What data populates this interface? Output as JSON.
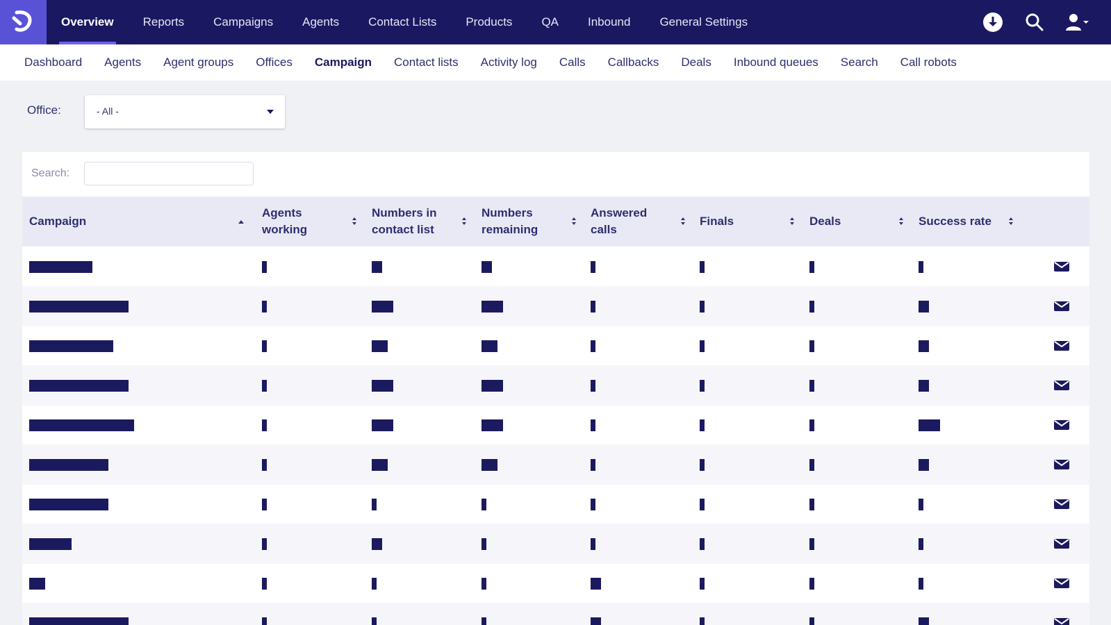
{
  "topnav": {
    "items": [
      "Overview",
      "Reports",
      "Campaigns",
      "Agents",
      "Contact Lists",
      "Products",
      "QA",
      "Inbound",
      "General Settings"
    ],
    "active_index": 0,
    "icons": [
      "download-icon",
      "search-icon",
      "user-menu-icon"
    ]
  },
  "subnav": {
    "items": [
      "Dashboard",
      "Agents",
      "Agent groups",
      "Offices",
      "Campaign",
      "Contact lists",
      "Activity log",
      "Calls",
      "Callbacks",
      "Deals",
      "Inbound queues",
      "Search",
      "Call robots"
    ],
    "active_index": 4
  },
  "filter": {
    "office_label": "Office:",
    "office_value": "- All -"
  },
  "table": {
    "search_label": "Search:",
    "search_value": "",
    "columns": [
      {
        "label": "Campaign",
        "sort": "asc"
      },
      {
        "label": "Agents working",
        "sort": "both"
      },
      {
        "label": "Numbers in contact list",
        "sort": "both"
      },
      {
        "label": "Numbers remaining",
        "sort": "both"
      },
      {
        "label": "Answered calls",
        "sort": "both"
      },
      {
        "label": "Finals",
        "sort": "both"
      },
      {
        "label": "Deals",
        "sort": "both"
      },
      {
        "label": "Success rate",
        "sort": "both"
      }
    ],
    "row_count": 10,
    "row_action_icon": "mail-icon",
    "cell_note": "cell values are redacted in the screenshot (shown as solid blocks)"
  },
  "colors": {
    "topbar": "#1b1862",
    "logo_bg": "#5a52d6",
    "accent": "#6a61ee",
    "header_row": "#e9e9f6",
    "redaction": "#1c1a5e"
  }
}
